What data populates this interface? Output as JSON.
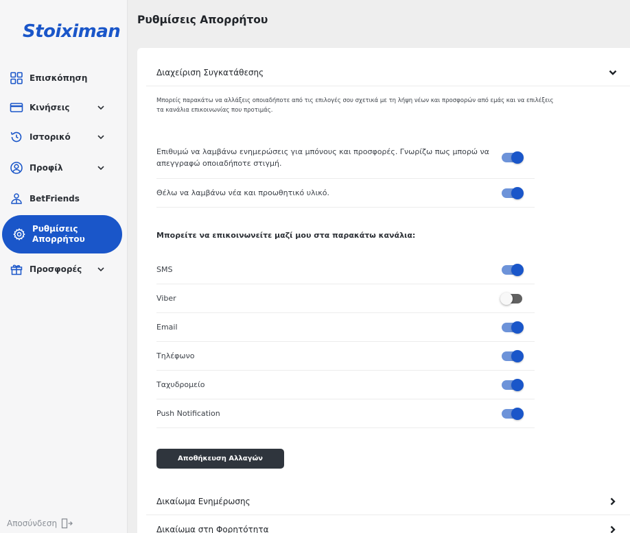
{
  "brand": {
    "logo_text": "Stoiximan"
  },
  "sidebar": {
    "items": [
      {
        "label": "Επισκόπηση",
        "icon": "grid-icon",
        "has_chevron": false
      },
      {
        "label": "Κινήσεις",
        "icon": "credit-card-icon",
        "has_chevron": true
      },
      {
        "label": "Ιστορικό",
        "icon": "history-icon",
        "has_chevron": true
      },
      {
        "label": "Προφίλ",
        "icon": "user-icon",
        "has_chevron": true
      },
      {
        "label": "BetFriends",
        "icon": "friends-icon",
        "has_chevron": false
      },
      {
        "label": "Ρυθμίσεις Απορρήτου",
        "icon": "gear-icon",
        "has_chevron": false,
        "active": true
      },
      {
        "label": "Προσφορές",
        "icon": "gift-icon",
        "has_chevron": true
      }
    ],
    "logout_label": "Αποσύνδεση"
  },
  "header": {
    "title": "Ρυθμίσεις Απορρήτου"
  },
  "consent": {
    "title": "Διαχείριση Συγκατάθεσης",
    "intro": "Μπορείς παρακάτω να αλλάξεις οποιαδήποτε από τις επιλογές σου σχετικά με τη λήψη νέων και προσφορών από εμάς και να επιλέξεις τα κανάλια επικοινωνίας που προτιμάς.",
    "preferences": [
      {
        "label": "Επιθυμώ να λαμβάνω ενημερώσεις για μπόνους και προσφορές. Γνωρίζω πως μπορώ να απεγγραφώ οποιαδήποτε στιγμή.",
        "enabled": true
      },
      {
        "label": "Θέλω να λαμβάνω νέα και προωθητικό υλικό.",
        "enabled": true
      }
    ],
    "channels_label": "Μπορείτε να επικοινωνείτε μαζί μου στα παρακάτω κανάλια:",
    "channels": [
      {
        "label": "SMS",
        "enabled": true
      },
      {
        "label": "Viber",
        "enabled": false
      },
      {
        "label": "Email",
        "enabled": true
      },
      {
        "label": "Τηλέφωνο",
        "enabled": true
      },
      {
        "label": "Ταχυδρομείο",
        "enabled": true
      },
      {
        "label": "Push Notification",
        "enabled": true
      }
    ],
    "save_label": "Αποθήκευση Αλλαγών"
  },
  "other_sections": [
    {
      "title": "Δικαίωμα Ενημέρωσης"
    },
    {
      "title": "Δικαίωμα στη Φορητότητα"
    }
  ],
  "colors": {
    "accent": "#1a56c9",
    "button_dark": "#2f353d",
    "toggle_off": "#616161"
  }
}
